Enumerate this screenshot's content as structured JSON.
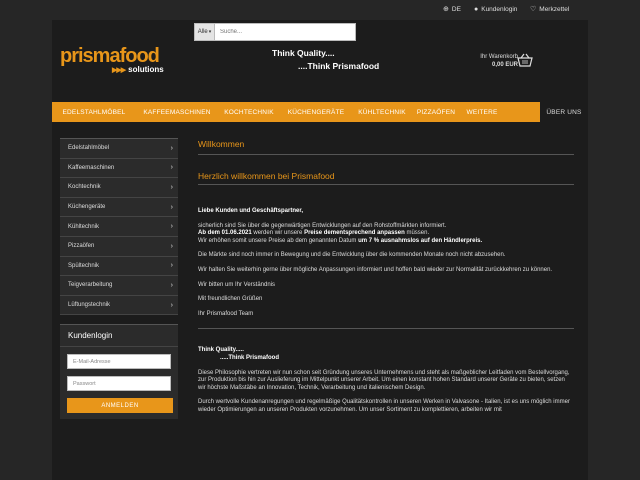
{
  "topbar": {
    "language": "DE",
    "account": "Kundenlogin",
    "wishlist": "Merkzettel"
  },
  "search": {
    "category": "Alle",
    "placeholder": "Suche..."
  },
  "logo": {
    "word": "prismafood",
    "sub": "solutions",
    "arrows": "▶▶▶"
  },
  "tagline": {
    "line1": "Think Quality....",
    "line2": "....Think Prismafood"
  },
  "cart": {
    "label": "Ihr Warenkorb",
    "amount": "0,00 EUR"
  },
  "nav": {
    "items": [
      "EDELSTAHLMÖBEL",
      "KAFFEEMASCHINEN",
      "KOCHTECHNIK",
      "KÜCHENGERÄTE",
      "KÜHLTECHNIK",
      "PIZZAÖFEN",
      "WEITERE"
    ],
    "about": "ÜBER UNS"
  },
  "categories": [
    "Edelstahlmöbel",
    "Kaffeemaschinen",
    "Kochtechnik",
    "Küchengeräte",
    "Kühltechnik",
    "Pizzaöfen",
    "Spültechnik",
    "Teigverarbeitung",
    "Lüftungstechnik"
  ],
  "login": {
    "title": "Kundenlogin",
    "email_placeholder": "E-Mail-Adresse",
    "password_placeholder": "Passwort",
    "button": "ANMELDEN"
  },
  "main": {
    "heading": "Willkommen",
    "subheading": "Herzlich willkommen bei Prismafood",
    "greeting": "Liebe Kunden und Geschäftspartner,",
    "p1": "sicherlich sind Sie über die gegenwärtigen Entwicklungen auf den Rohstoffmärkten informiert.",
    "p2a": "Ab dem 01.06.2021",
    "p2b": " werden wir unsere ",
    "p2c": "Preise dementsprechend anpassen",
    "p2d": " müssen.",
    "p3a": "Wir erhöhen somit unsere Preise ab dem genannten Datum ",
    "p3b": "um 7 % ausnahmslos auf den Händlerpreis.",
    "p4": "Die Märkte sind noch immer in Bewegung und die Entwicklung über die kommenden Monate noch nicht abzusehen.",
    "p5": "Wir halten Sie weiterhin gerne über mögliche Anpassungen informiert und hoffen bald wieder zur Normalität zurückkehren zu können.",
    "p6": "Wir bitten um Ihr Verständnis",
    "p7": "Mit freundlichen Grüßen",
    "p8": "Ihr Prismafood Team",
    "t1": "Think Quality.....",
    "t2": ".....Think Prismafood",
    "p9": "Diese Philosophie vertreten wir nun schon seit Gründung unseres Unternehmens und steht als maßgeblicher Leitfaden vom Bestellvorgang, zur Produktion bis hin zur Auslieferung im Mittelpunkt unserer Arbeit. Um einen konstant hohen Standard unserer Geräte zu bieten, setzen wir höchste Maßstäbe an Innovation, Technik, Verarbeitung und italienischem Design.",
    "p10": "Durch wertvolle Kundenanregungen und regelmäßige Qualitätskontrollen in unseren Werken in Valvasone - Italien, ist es uns möglich immer wieder Optimierungen an unseren Produkten vorzunehmen. Um unser Sortiment zu komplettieren, arbeiten wir mit"
  }
}
